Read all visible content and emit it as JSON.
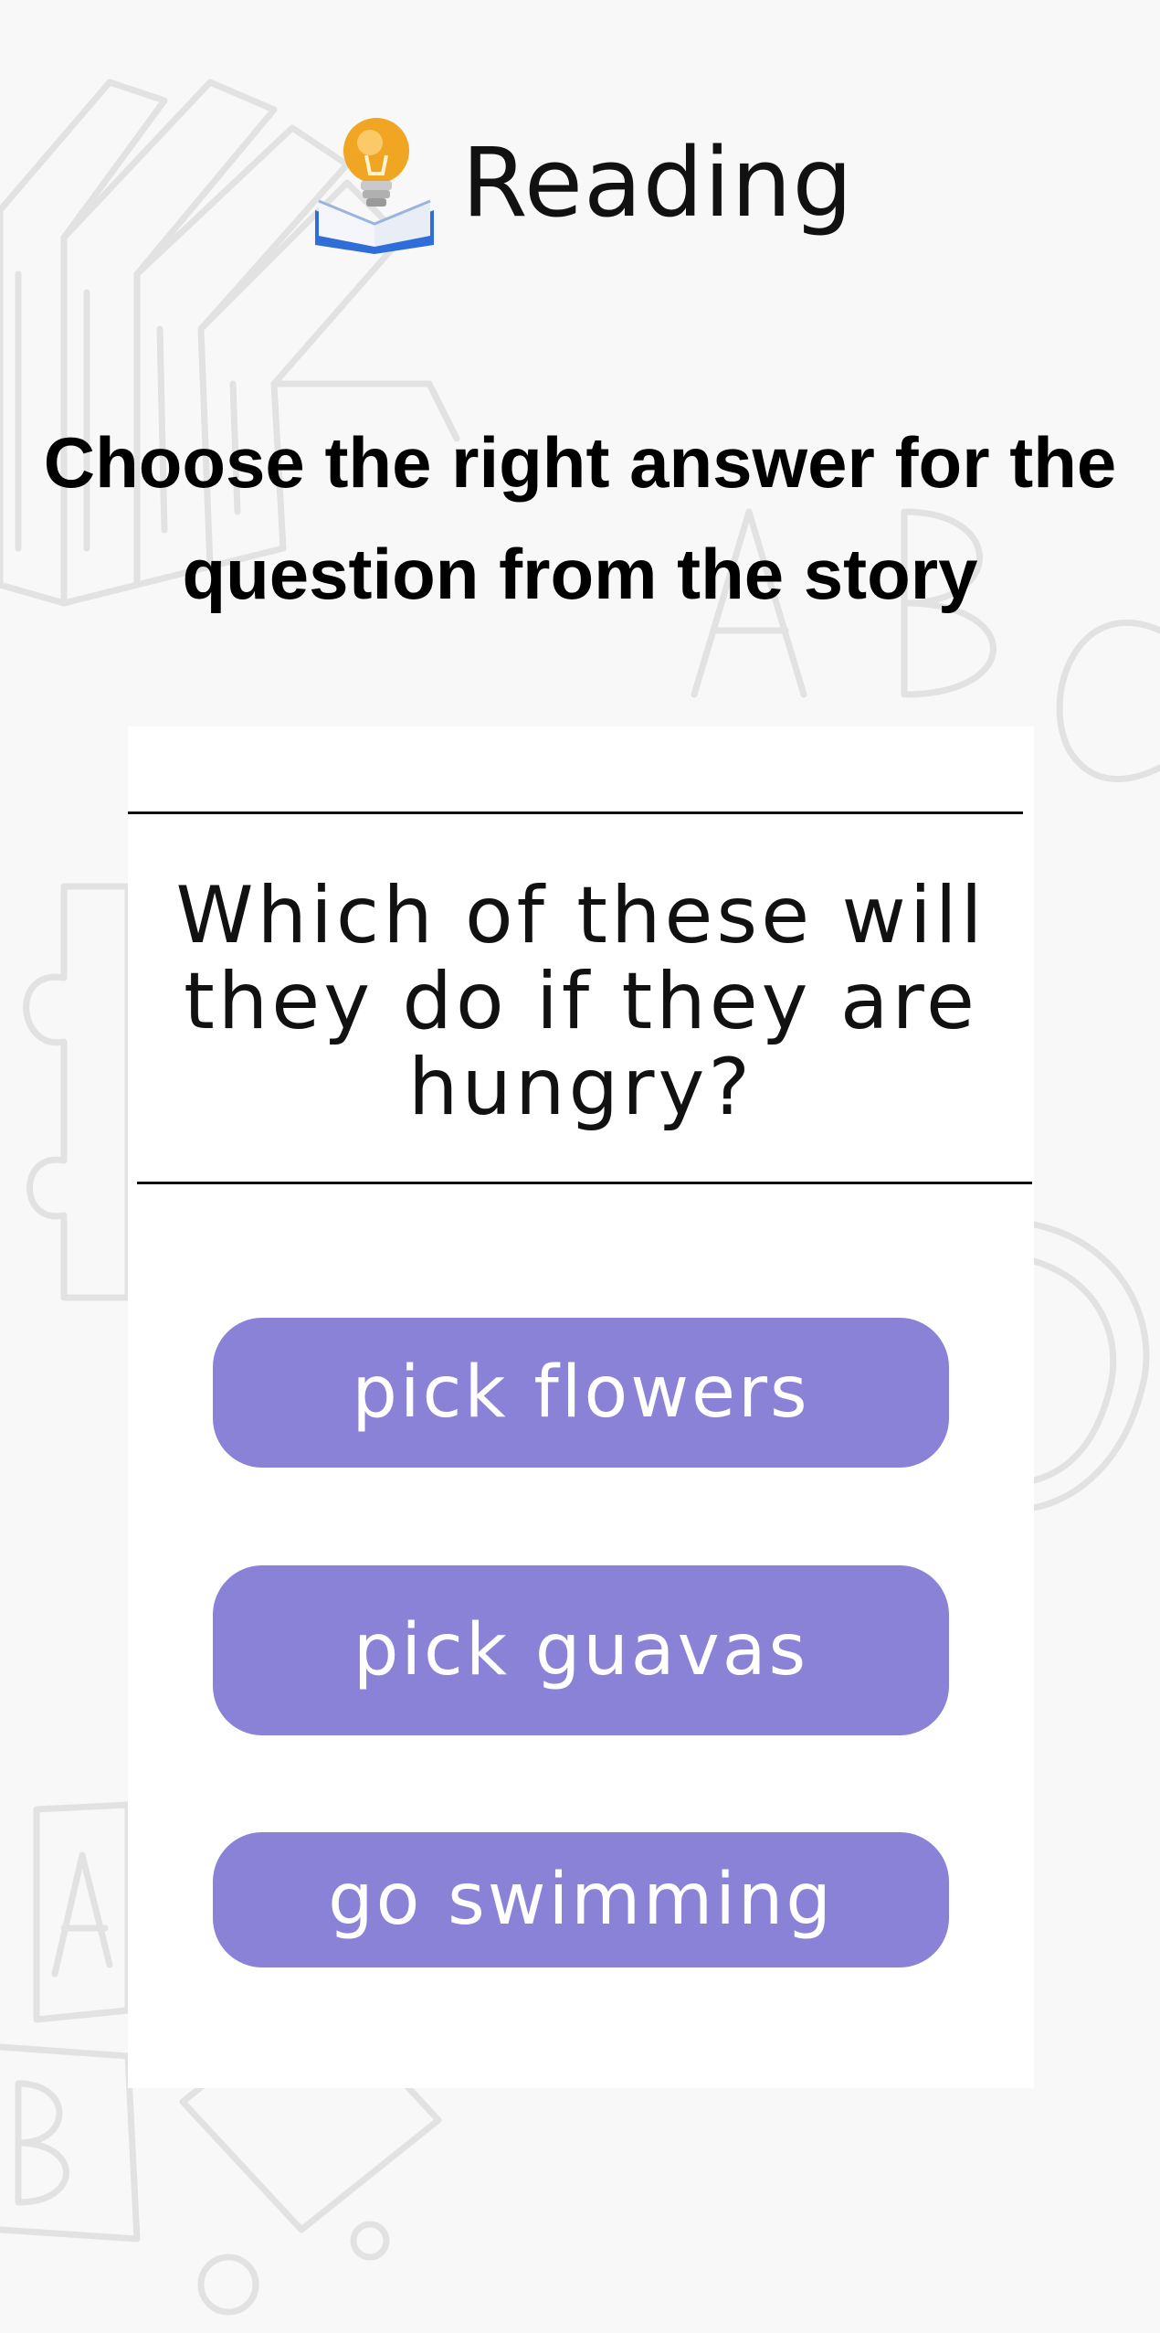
{
  "header": {
    "title": "Reading",
    "icon": "book-lightbulb-icon"
  },
  "instruction": "Choose the right answer for the question from the story",
  "question": "Which of these will they do if they are hungry?",
  "options": [
    {
      "label": "pick flowers"
    },
    {
      "label": "pick guavas"
    },
    {
      "label": "go swimming"
    }
  ],
  "colors": {
    "background": "#f8f8f8",
    "card": "#ffffff",
    "option_button": "#8a82d6",
    "option_text": "#ffffff",
    "text": "#111111",
    "doodle": "#e3e3e3"
  }
}
